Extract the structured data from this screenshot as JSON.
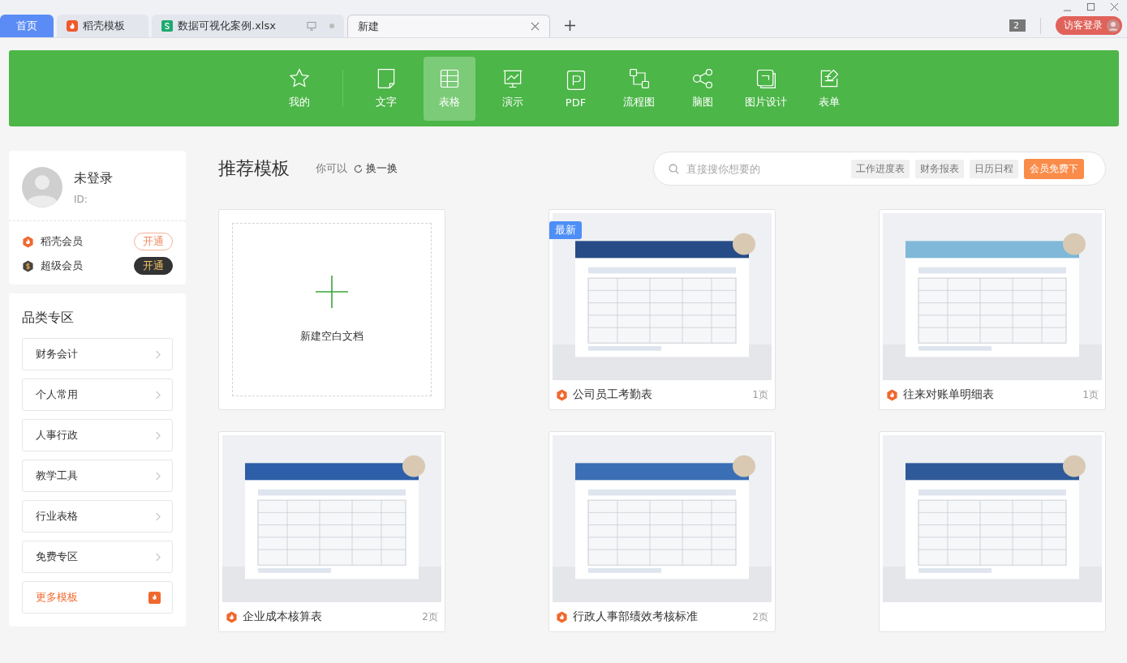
{
  "tabs": [
    {
      "label": "首页",
      "kind": "home",
      "selected": false
    },
    {
      "label": "稻壳模板",
      "kind": "docer",
      "selected": false
    },
    {
      "label": "数据可视化案例.xlsx",
      "kind": "sheet",
      "selected": false
    },
    {
      "label": "新建",
      "kind": "plain",
      "selected": true
    }
  ],
  "window_controls": {
    "tab_count": "2",
    "login_button": "访客登录"
  },
  "toolbar": [
    {
      "label": "我的",
      "selected": false
    },
    {
      "label": "文字",
      "selected": false
    },
    {
      "label": "表格",
      "selected": true
    },
    {
      "label": "演示",
      "selected": false
    },
    {
      "label": "PDF",
      "selected": false
    },
    {
      "label": "流程图",
      "selected": false
    },
    {
      "label": "脑图",
      "selected": false
    },
    {
      "label": "图片设计",
      "selected": false
    },
    {
      "label": "表单",
      "selected": false
    }
  ],
  "user": {
    "name": "未登录",
    "id": "ID:",
    "memberships": [
      {
        "name": "稻壳会员",
        "button": "开通",
        "kind": "docer"
      },
      {
        "name": "超级会员",
        "button": "开通",
        "kind": "super"
      }
    ]
  },
  "categories": {
    "title": "品类专区",
    "items": [
      "财务会计",
      "个人常用",
      "人事行政",
      "教学工具",
      "行业表格",
      "免费专区"
    ],
    "more": "更多模板"
  },
  "main": {
    "title": "推荐模板",
    "hint": "你可以",
    "refresh": "换一换",
    "search": {
      "placeholder": "直接搜你想要的"
    },
    "tags": [
      "工作进度表",
      "财务报表",
      "日历日程"
    ],
    "promo": "会员免费下"
  },
  "cards": [
    {
      "kind": "blank",
      "label": "新建空白文档"
    },
    {
      "kind": "template",
      "title": "公司员工考勤表",
      "pages": "1页",
      "badge": "最新"
    },
    {
      "kind": "template",
      "title": "往来对账单明细表",
      "pages": "1页"
    },
    {
      "kind": "template",
      "title": "企业成本核算表",
      "pages": "2页"
    },
    {
      "kind": "template",
      "title": "行政人事部绩效考核标准",
      "pages": "2页"
    },
    {
      "kind": "template"
    }
  ]
}
